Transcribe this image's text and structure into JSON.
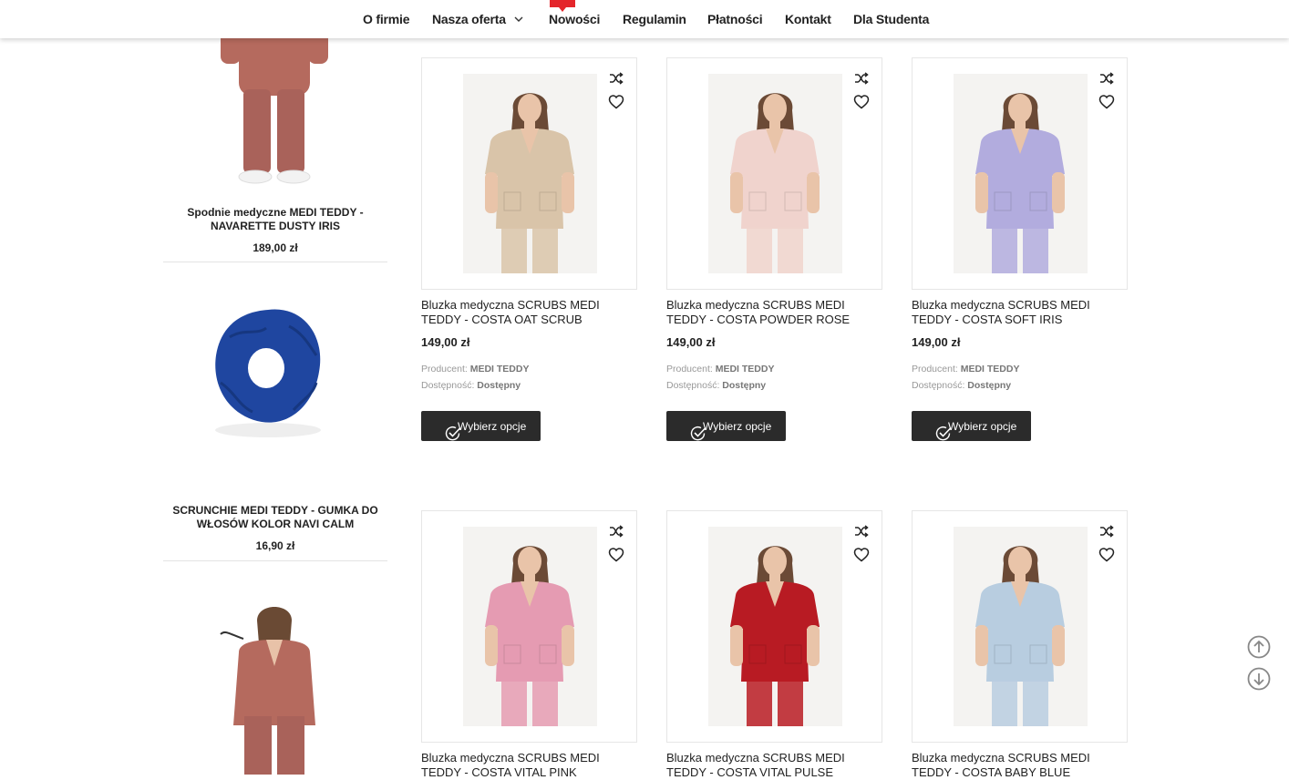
{
  "nav": {
    "items": [
      "O firmie",
      "Nasza oferta",
      "Nowości",
      "Regulamin",
      "Płatności",
      "Kontakt",
      "Dla Studenta"
    ]
  },
  "sidebar": {
    "products": [
      {
        "title": "Spodnie medyczne MEDI TEDDY - NAVARETTE DUSTY IRIS",
        "price": "189,00 zł",
        "image": "rose-scrubs-model"
      },
      {
        "title": "SCRUNCHIE MEDI TEDDY - GUMKA DO WŁOSÓW KOLOR NAVI CALM",
        "price": "16,90 zł",
        "image": "navy-scrunchie"
      },
      {
        "title": "",
        "price": "",
        "image": "rose-scrubs-stethoscope-model"
      }
    ]
  },
  "labels": {
    "producer": "Producent:",
    "availability": "Dostępność:",
    "choose_options": "Wybierz opcje"
  },
  "products": [
    {
      "title": "Bluzka medyczna SCRUBS MEDI TEDDY - COSTA OAT SCRUB",
      "price": "149,00 zł",
      "producer": "MEDI TEDDY",
      "availability": "Dostępny",
      "color": "#d9c4a9"
    },
    {
      "title": "Bluzka medyczna SCRUBS MEDI TEDDY - COSTA POWDER ROSE",
      "price": "149,00 zł",
      "producer": "MEDI TEDDY",
      "availability": "Dostępny",
      "color": "#f0d3cd"
    },
    {
      "title": "Bluzka medyczna SCRUBS MEDI TEDDY - COSTA SOFT IRIS",
      "price": "149,00 zł",
      "producer": "MEDI TEDDY",
      "availability": "Dostępny",
      "color": "#b2acde"
    },
    {
      "title": "Bluzka medyczna SCRUBS MEDI TEDDY - COSTA VITAL PINK",
      "price": "",
      "producer": "",
      "availability": "",
      "color": "#e59bb2"
    },
    {
      "title": "Bluzka medyczna SCRUBS MEDI TEDDY - COSTA VITAL PULSE",
      "price": "",
      "producer": "",
      "availability": "",
      "color": "#b81b23"
    },
    {
      "title": "Bluzka medyczna SCRUBS MEDI TEDDY - COSTA BABY BLUE",
      "price": "",
      "producer": "",
      "availability": "",
      "color": "#b8cde0"
    }
  ],
  "colors": {
    "nav_text": "#222222",
    "badge": "#e4262b",
    "button": "#2b2b2b",
    "meta_text": "#999999"
  },
  "icons": [
    "shuffle-icon",
    "heart-icon",
    "check-circle-icon",
    "chevron-down-icon",
    "arrow-up-circle-icon",
    "arrow-down-circle-icon"
  ]
}
